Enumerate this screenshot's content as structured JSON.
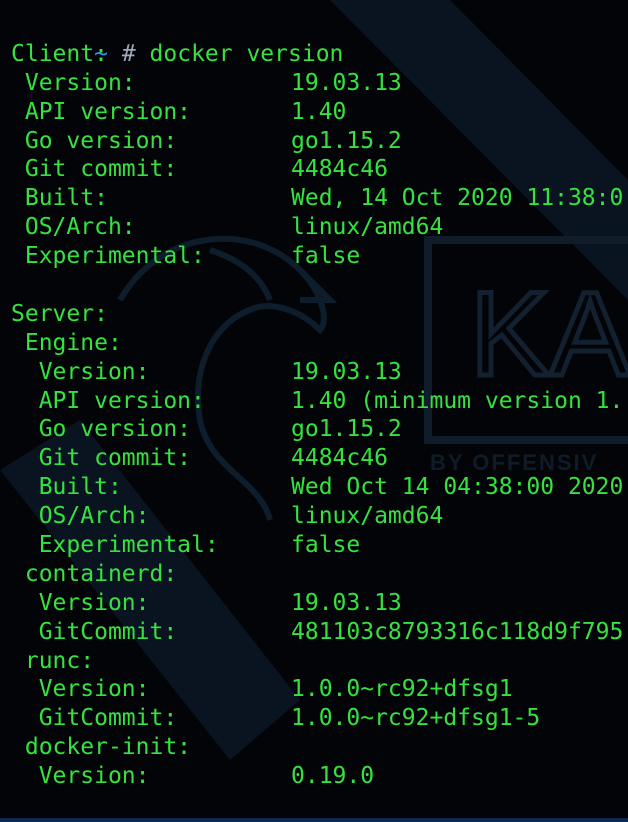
{
  "prompt": {
    "tilde": "~",
    "hash": "#",
    "command": "docker version"
  },
  "client": {
    "header": "Client:",
    "rows": [
      {
        "key": "Version:",
        "value": "19.03.13"
      },
      {
        "key": "API version:",
        "value": "1.40"
      },
      {
        "key": "Go version:",
        "value": "go1.15.2"
      },
      {
        "key": "Git commit:",
        "value": "4484c46"
      },
      {
        "key": "Built:",
        "value": "Wed, 14 Oct 2020 11:38:0"
      },
      {
        "key": "OS/Arch:",
        "value": "linux/amd64"
      },
      {
        "key": "Experimental:",
        "value": "false"
      }
    ]
  },
  "server": {
    "header": "Server:",
    "engine": {
      "header": "Engine:",
      "rows": [
        {
          "key": "Version:",
          "value": "19.03.13"
        },
        {
          "key": "API version:",
          "value": "1.40 (minimum version 1."
        },
        {
          "key": "Go version:",
          "value": "go1.15.2"
        },
        {
          "key": "Git commit:",
          "value": "4484c46"
        },
        {
          "key": "Built:",
          "value": "Wed Oct 14 04:38:00 2020"
        },
        {
          "key": "OS/Arch:",
          "value": "linux/amd64"
        },
        {
          "key": "Experimental:",
          "value": "false"
        }
      ]
    },
    "containerd": {
      "header": "containerd:",
      "rows": [
        {
          "key": "Version:",
          "value": "19.03.13"
        },
        {
          "key": "GitCommit:",
          "value": "481103c8793316c118d9f795"
        }
      ]
    },
    "runc": {
      "header": "runc:",
      "rows": [
        {
          "key": "Version:",
          "value": "1.0.0~rc92+dfsg1"
        },
        {
          "key": "GitCommit:",
          "value": "1.0.0~rc92+dfsg1-5"
        }
      ]
    },
    "docker_init": {
      "header": "docker-init:",
      "rows": [
        {
          "key": "Version:",
          "value": "0.19.0"
        }
      ]
    }
  },
  "wallpaper": {
    "logo_text": "KA",
    "tagline": "BY OFFENSIV"
  },
  "colors": {
    "terminal_text": "#36e23f",
    "prompt_tilde": "#3b8eea",
    "background": "#020407"
  }
}
